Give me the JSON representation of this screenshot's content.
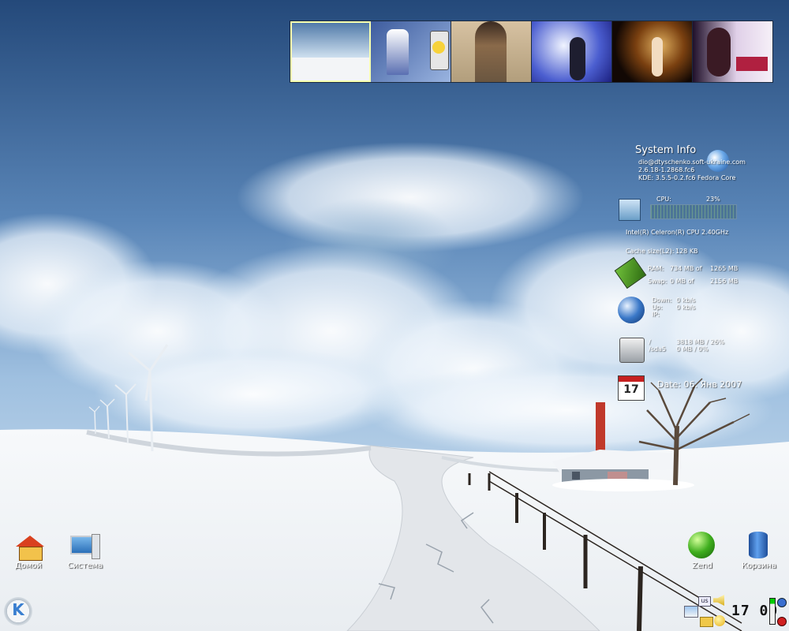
{
  "pager": {
    "desktops": [
      {
        "name": "desktop-1",
        "active": true,
        "theme": "snow-landscape"
      },
      {
        "name": "desktop-2",
        "active": false,
        "theme": "anime-blue"
      },
      {
        "name": "desktop-3",
        "active": false,
        "theme": "photo-beige"
      },
      {
        "name": "desktop-4",
        "active": false,
        "theme": "fantasy-blue"
      },
      {
        "name": "desktop-5",
        "active": false,
        "theme": "angel-dark"
      },
      {
        "name": "desktop-6",
        "active": false,
        "theme": "fantasy-purple"
      }
    ]
  },
  "sysinfo": {
    "title": "System Info",
    "user": "dio@dtyschenko.soft-ukraine.com",
    "kernel": "2.6.18-1.2868.fc6",
    "kde": "KDE: 3.5.5-0.2.fc6 Fedora Core",
    "cpu_label": "CPU:",
    "cpu_value": "23%",
    "cpu_model": "Intel(R) Celeron(R) CPU 2.40GHz",
    "cache_label": "Cache size(L2):",
    "cache_value": "128 KB",
    "ram_label": "RAM:",
    "ram_used": "734 MB of",
    "ram_total": "1265 MB",
    "swap_label": "Swap:",
    "swap_used": "0 MB of",
    "swap_total": "2156 MB",
    "down_label": "Down:",
    "down_value": "0 kb/s",
    "up_label": "Up:",
    "up_value": "0 kb/s",
    "ip_label": "IP:",
    "fs1_name": "/",
    "fs1_value": "3818 MB / 26%",
    "fs2_name": "/sda5",
    "fs2_value": "0 MB / 0%",
    "calendar_day": "17",
    "date": "Date: 06. Янв 2007"
  },
  "desktop_icons": {
    "home": "Домой",
    "system": "Система",
    "zend": "Zend",
    "trash": "Корзина"
  },
  "tray": {
    "kbd_layout": "us",
    "clock": "17 00"
  },
  "colors": {
    "sky_top": "#2a4f80",
    "sky_mid": "#6b93c2",
    "snow": "#f4f6f8",
    "pager_active": "#f6ffb0"
  }
}
